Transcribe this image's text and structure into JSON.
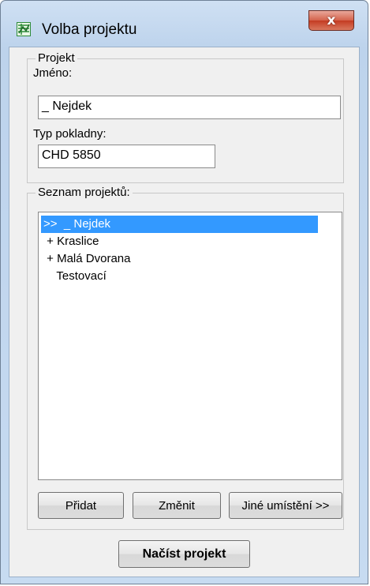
{
  "window": {
    "title": "Volba projektu",
    "close_glyph": "x"
  },
  "project_group": {
    "legend": "Projekt",
    "name_label": "Jméno:",
    "name_value": "_ Nejdek",
    "register_label": "Typ pokladny:",
    "register_value": "CHD 5850"
  },
  "list_group": {
    "legend": "Seznam projektů:",
    "items": [
      {
        "text": ">>  _ Nejdek",
        "selected": true
      },
      {
        "text": " + Kraslice",
        "selected": false
      },
      {
        "text": " + Malá Dvorana",
        "selected": false
      },
      {
        "text": "    Testovací",
        "selected": false
      }
    ],
    "add_label": "Přidat",
    "change_label": "Změnit",
    "other_location_label": "Jiné umístění >>"
  },
  "footer": {
    "load_label": "Načíst projekt"
  },
  "colors": {
    "selection": "#3399ff",
    "app_icon": "#2e8b3a"
  },
  "icons": {
    "app": "spreadsheet-icon",
    "close": "close-icon"
  }
}
